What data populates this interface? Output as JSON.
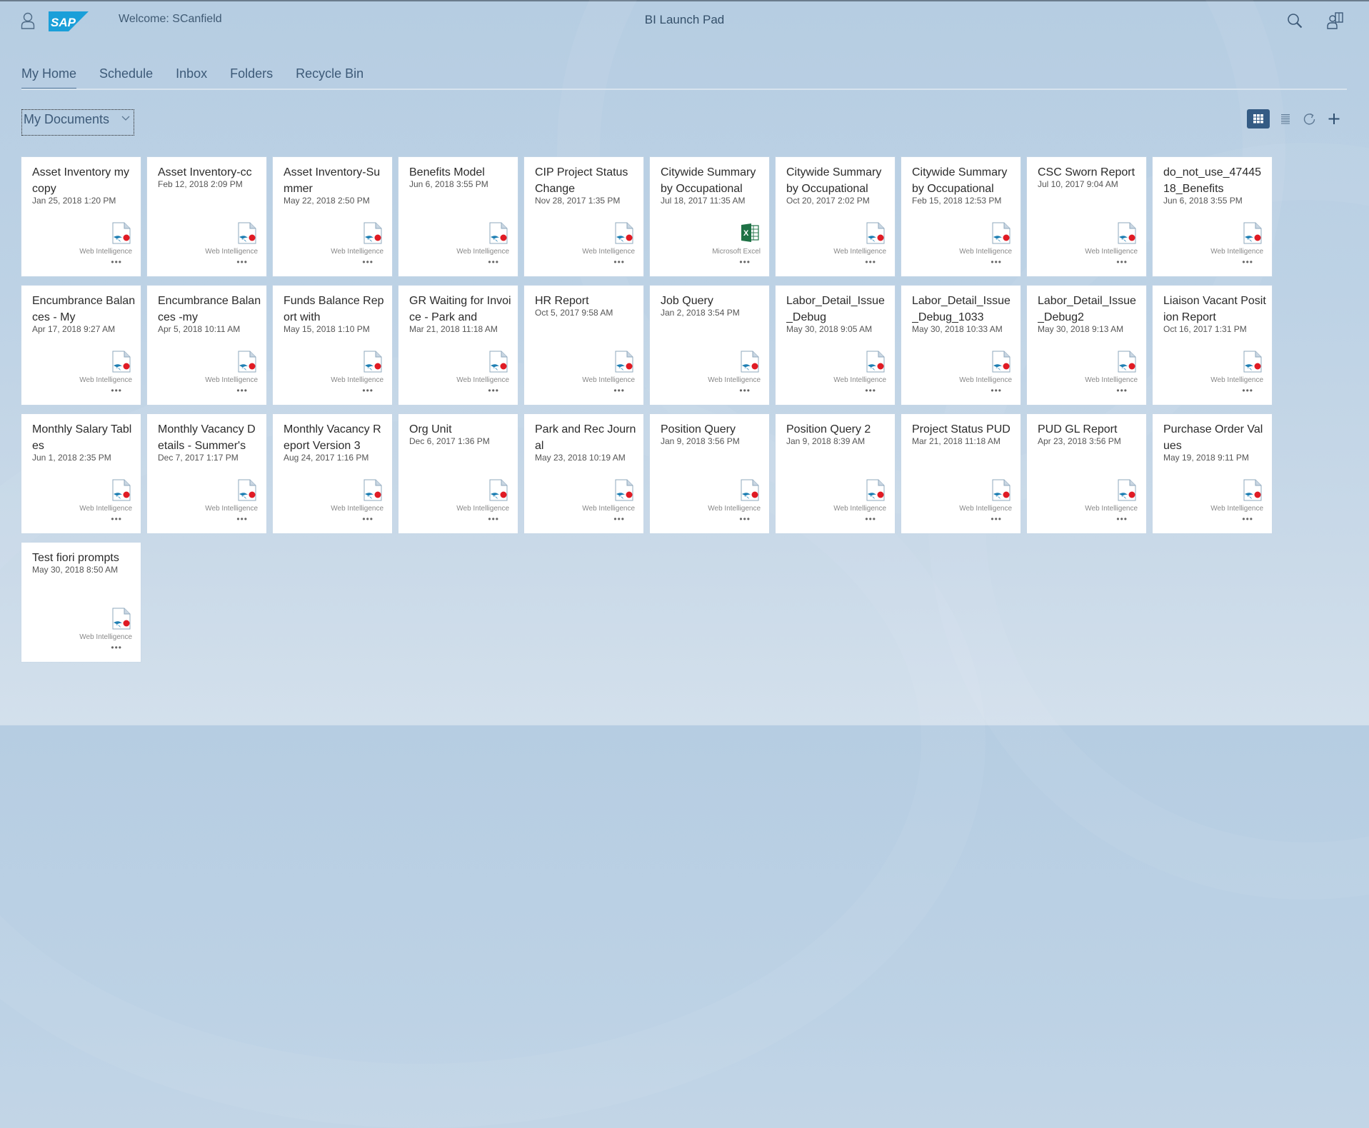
{
  "header": {
    "welcome": "Welcome: SCanfield",
    "title": "BI Launch Pad",
    "logo_text": "SAP"
  },
  "tabs": [
    {
      "label": "My Home",
      "active": true
    },
    {
      "label": "Schedule",
      "active": false
    },
    {
      "label": "Inbox",
      "active": false
    },
    {
      "label": "Folders",
      "active": false
    },
    {
      "label": "Recycle Bin",
      "active": false
    }
  ],
  "view_select": {
    "selected": "My Documents"
  },
  "toolbar": {
    "icons": [
      "grid-view-icon",
      "list-view-icon",
      "refresh-icon",
      "add-icon"
    ],
    "active_view": "grid"
  },
  "colors": {
    "accent": "#345b84",
    "sap_blue": "#1a9fd9",
    "webi_red": "#e01b24",
    "excel_green": "#1e7145"
  },
  "documents": [
    {
      "title": "Asset Inventory my copy",
      "date": "Jan 25, 2018 1:20 PM",
      "type": "Web Intelligence",
      "icon": "webi"
    },
    {
      "title": "Asset Inventory-cc",
      "date": "Feb 12, 2018 2:09 PM",
      "type": "Web Intelligence",
      "icon": "webi"
    },
    {
      "title": "Asset Inventory-Summer",
      "date": "May 22, 2018 2:50 PM",
      "type": "Web Intelligence",
      "icon": "webi"
    },
    {
      "title": "Benefits Model",
      "date": "Jun 6, 2018 3:55 PM",
      "type": "Web Intelligence",
      "icon": "webi"
    },
    {
      "title": "CIP Project Status Change",
      "date": "Nov 28, 2017 1:35 PM",
      "type": "Web Intelligence",
      "icon": "webi"
    },
    {
      "title": "Citywide Summary by Occupational",
      "date": "Jul 18, 2017 11:35 AM",
      "type": "Microsoft Excel",
      "icon": "excel"
    },
    {
      "title": "Citywide Summary by Occupational",
      "date": "Oct 20, 2017 2:02 PM",
      "type": "Web Intelligence",
      "icon": "webi"
    },
    {
      "title": "Citywide Summary by Occupational",
      "date": "Feb 15, 2018 12:53 PM",
      "type": "Web Intelligence",
      "icon": "webi"
    },
    {
      "title": "CSC Sworn Report",
      "date": "Jul 10, 2017 9:04 AM",
      "type": "Web Intelligence",
      "icon": "webi"
    },
    {
      "title": "do_not_use_4744518_Benefits",
      "date": "Jun 6, 2018 3:55 PM",
      "type": "Web Intelligence",
      "icon": "webi"
    },
    {
      "title": "Encumbrance Balances - My",
      "date": "Apr 17, 2018 9:27 AM",
      "type": "Web Intelligence",
      "icon": "webi"
    },
    {
      "title": "Encumbrance Balances -my",
      "date": "Apr 5, 2018 10:11 AM",
      "type": "Web Intelligence",
      "icon": "webi"
    },
    {
      "title": "Funds Balance Report with",
      "date": "May 15, 2018 1:10 PM",
      "type": "Web Intelligence",
      "icon": "webi"
    },
    {
      "title": "GR Waiting for Invoice - Park and",
      "date": "Mar 21, 2018 11:18 AM",
      "type": "Web Intelligence",
      "icon": "webi"
    },
    {
      "title": "HR Report",
      "date": "Oct 5, 2017 9:58 AM",
      "type": "Web Intelligence",
      "icon": "webi"
    },
    {
      "title": "Job Query",
      "date": "Jan 2, 2018 3:54 PM",
      "type": "Web Intelligence",
      "icon": "webi"
    },
    {
      "title": "Labor_Detail_Issue_Debug",
      "date": "May 30, 2018 9:05 AM",
      "type": "Web Intelligence",
      "icon": "webi"
    },
    {
      "title": "Labor_Detail_Issue_Debug_1033",
      "date": "May 30, 2018 10:33 AM",
      "type": "Web Intelligence",
      "icon": "webi"
    },
    {
      "title": "Labor_Detail_Issue_Debug2",
      "date": "May 30, 2018 9:13 AM",
      "type": "Web Intelligence",
      "icon": "webi"
    },
    {
      "title": "Liaison Vacant Position Report",
      "date": "Oct 16, 2017 1:31 PM",
      "type": "Web Intelligence",
      "icon": "webi"
    },
    {
      "title": "Monthly Salary Tables",
      "date": "Jun 1, 2018 2:35 PM",
      "type": "Web Intelligence",
      "icon": "webi"
    },
    {
      "title": "Monthly Vacancy Details - Summer's",
      "date": "Dec 7, 2017 1:17 PM",
      "type": "Web Intelligence",
      "icon": "webi"
    },
    {
      "title": "Monthly Vacancy Report Version 3",
      "date": "Aug 24, 2017 1:16 PM",
      "type": "Web Intelligence",
      "icon": "webi"
    },
    {
      "title": "Org Unit",
      "date": "Dec 6, 2017 1:36 PM",
      "type": "Web Intelligence",
      "icon": "webi"
    },
    {
      "title": "Park and Rec Journal",
      "date": "May 23, 2018 10:19 AM",
      "type": "Web Intelligence",
      "icon": "webi"
    },
    {
      "title": "Position Query",
      "date": "Jan 9, 2018 3:56 PM",
      "type": "Web Intelligence",
      "icon": "webi"
    },
    {
      "title": "Position Query 2",
      "date": "Jan 9, 2018 8:39 AM",
      "type": "Web Intelligence",
      "icon": "webi"
    },
    {
      "title": "Project Status PUD",
      "date": "Mar 21, 2018 11:18 AM",
      "type": "Web Intelligence",
      "icon": "webi"
    },
    {
      "title": "PUD GL Report",
      "date": "Apr 23, 2018 3:56 PM",
      "type": "Web Intelligence",
      "icon": "webi"
    },
    {
      "title": "Purchase Order Values",
      "date": "May 19, 2018 9:11 PM",
      "type": "Web Intelligence",
      "icon": "webi"
    },
    {
      "title": "Test fiori prompts",
      "date": "May 30, 2018 8:50 AM",
      "type": "Web Intelligence",
      "icon": "webi"
    }
  ],
  "tile_more_label": "•••"
}
